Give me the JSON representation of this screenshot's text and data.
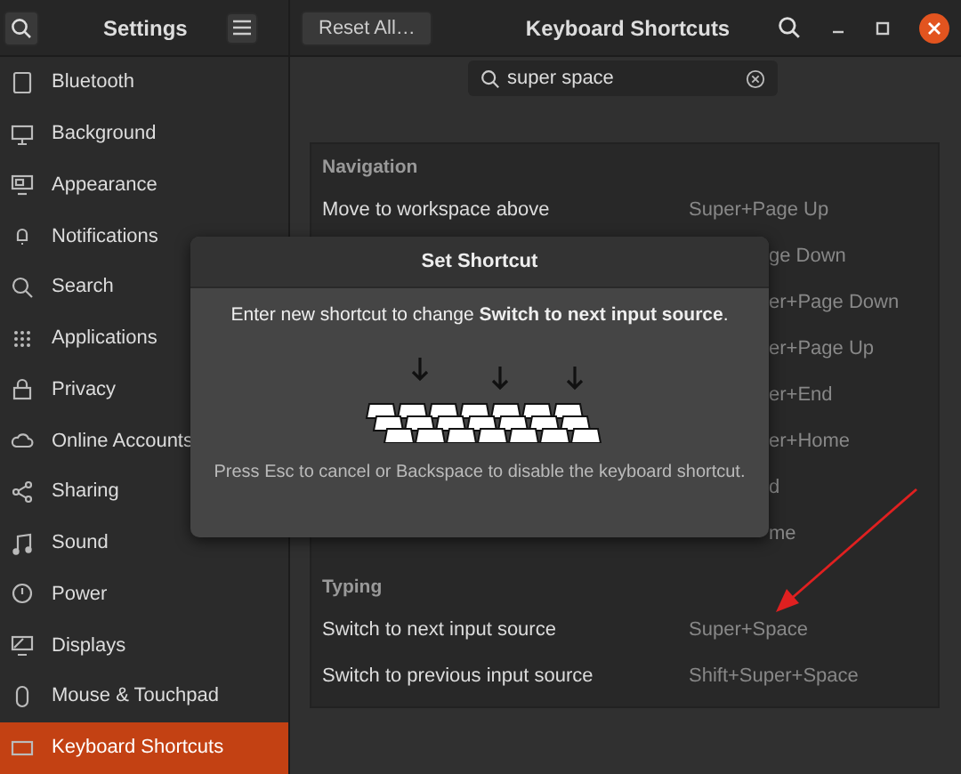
{
  "header": {
    "title": "Settings",
    "reset_button": "Reset All…",
    "page_title": "Keyboard Shortcuts"
  },
  "sidebar": {
    "items": [
      {
        "label": "Bluetooth",
        "selected": false
      },
      {
        "label": "Background",
        "selected": false
      },
      {
        "label": "Appearance",
        "selected": false
      },
      {
        "label": "Notifications",
        "selected": false
      },
      {
        "label": "Search",
        "selected": false
      },
      {
        "label": "Applications",
        "selected": false
      },
      {
        "label": "Privacy",
        "selected": false
      },
      {
        "label": "Online Accounts",
        "selected": false
      },
      {
        "label": "Sharing",
        "selected": false
      },
      {
        "label": "Sound",
        "selected": false
      },
      {
        "label": "Power",
        "selected": false
      },
      {
        "label": "Displays",
        "selected": false
      },
      {
        "label": "Mouse & Touchpad",
        "selected": false
      },
      {
        "label": "Keyboard Shortcuts",
        "selected": true
      }
    ]
  },
  "search": {
    "value": "super space"
  },
  "sections": [
    {
      "title": "Navigation",
      "rows": [
        {
          "name": "Move to workspace above",
          "shortcut": "Super+Page Up"
        },
        {
          "shortcut": "ge Down"
        },
        {
          "shortcut": "er+Page Down"
        },
        {
          "shortcut": "er+Page Up"
        },
        {
          "shortcut": "er+End"
        },
        {
          "shortcut": "er+Home"
        },
        {
          "shortcut": "d"
        },
        {
          "shortcut": "me"
        }
      ]
    },
    {
      "title": "Typing",
      "rows": [
        {
          "name": "Switch to next input source",
          "shortcut": "Super+Space"
        },
        {
          "name": "Switch to previous input source",
          "shortcut": "Shift+Super+Space"
        }
      ]
    }
  ],
  "dialog": {
    "title": "Set Shortcut",
    "message": "Enter new shortcut to change **Switch to next input source**.",
    "hint": "Press Esc to cancel or Backspace to disable the keyboard shortcut."
  }
}
